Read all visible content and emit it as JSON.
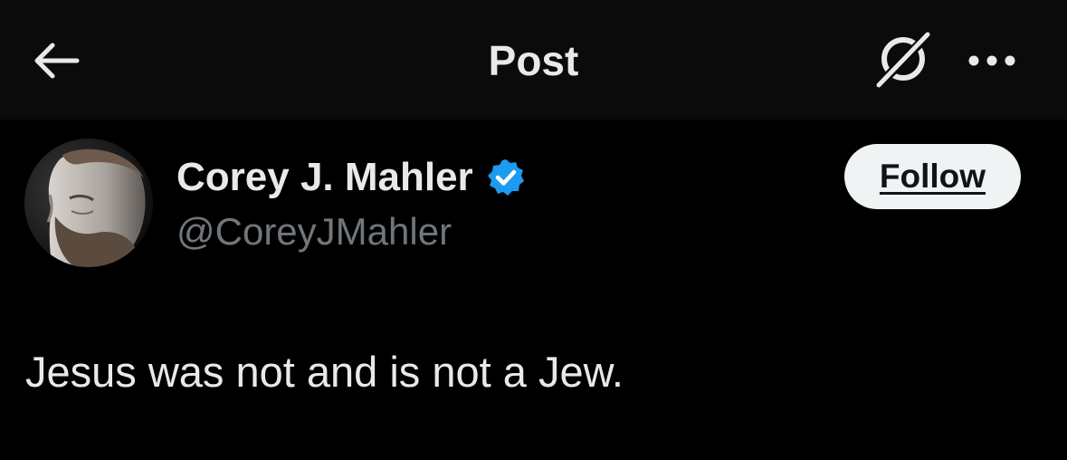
{
  "header": {
    "title": "Post",
    "back_icon": "arrow-left-icon",
    "grok_icon": "grok-icon",
    "more_icon": "more-horizontal-icon"
  },
  "author": {
    "name": "Corey J. Mahler",
    "handle": "@CoreyJMahler",
    "verified": true,
    "verified_color": "#1d9bf0",
    "avatar_icon": "user-avatar"
  },
  "follow_button": {
    "label": "Follow"
  },
  "post": {
    "text": "Jesus was not and is not a Jew."
  },
  "colors": {
    "background": "#000000",
    "header_background": "#0b0b0b",
    "primary_text": "#e7e9ea",
    "secondary_text": "#71767b",
    "follow_bg": "#eff3f4"
  }
}
